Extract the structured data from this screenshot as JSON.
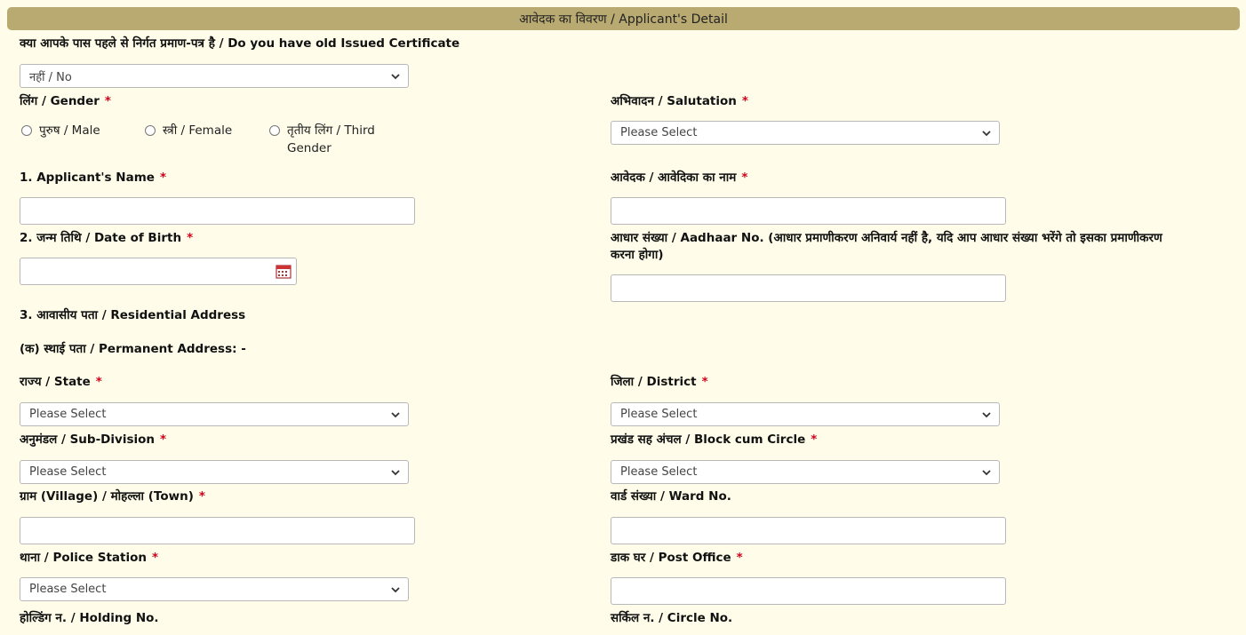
{
  "header": {
    "title": "आवेदक का विवरण / Applicant's Detail"
  },
  "old_certificate": {
    "label": "क्या आपके पास पहले से निर्गत प्रमाण-पत्र है / Do you have old Issued Certificate",
    "value": "नहीं / No"
  },
  "gender": {
    "label": "लिंग / Gender",
    "options": [
      "पुरुष / Male",
      "स्त्री / Female",
      "तृतीय लिंग / Third Gender"
    ]
  },
  "salutation": {
    "label": "अभिवादन / Salutation",
    "value": "Please Select"
  },
  "applicant_name": {
    "label": "1. Applicant's Name",
    "value": ""
  },
  "applicant_name_hindi": {
    "label": "आवेदक / आवेदिका का नाम",
    "value": ""
  },
  "dob": {
    "label": "2. जन्म तिथि / Date of Birth",
    "value": ""
  },
  "aadhaar": {
    "label": "आधार संख्या / Aadhaar No. (आधार प्रमाणीकरण अनिवार्य नहीं है, यदि आप आधार संख्या भरेंगे तो इसका प्रमाणीकरण करना होगा)",
    "value": ""
  },
  "residential_address": {
    "label": "3. आवासीय पता / Residential Address"
  },
  "permanent_address": {
    "label": "(क) स्थाई पता / Permanent Address: -"
  },
  "state": {
    "label": "राज्य / State",
    "value": "Please Select"
  },
  "district": {
    "label": "जिला / District",
    "value": "Please Select"
  },
  "subdivision": {
    "label": "अनुमंडल / Sub-Division",
    "value": "Please Select"
  },
  "block": {
    "label": "प्रखंड सह अंचल / Block cum Circle",
    "value": "Please Select"
  },
  "village": {
    "label": "ग्राम (Village) / मोहल्ला (Town)",
    "value": ""
  },
  "ward": {
    "label": "वार्ड संख्या / Ward No.",
    "value": ""
  },
  "police_station": {
    "label": "थाना / Police Station",
    "value": "Please Select"
  },
  "post_office": {
    "label": "डाक घर / Post Office",
    "value": ""
  },
  "holding": {
    "label": "होल्डिंग न. / Holding No."
  },
  "circle_no": {
    "label": "सर्किल न. / Circle No."
  },
  "required_mark": "*",
  "colors": {
    "header": "#b9aa72",
    "background": "#fffde9",
    "required": "#d0021b"
  }
}
